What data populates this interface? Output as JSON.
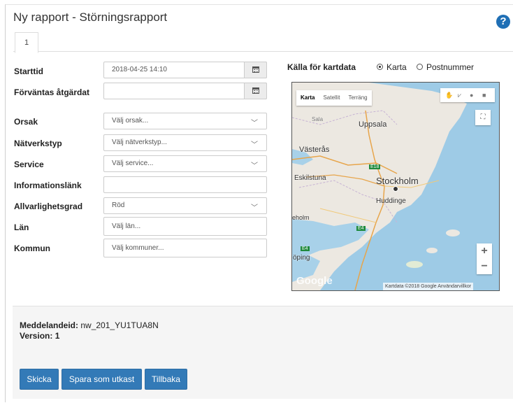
{
  "page": {
    "title": "Ny rapport - Störningsrapport",
    "help_icon": "question-circle-icon",
    "tabs": [
      {
        "label": "1"
      }
    ]
  },
  "form": {
    "starttid": {
      "label": "Starttid",
      "value": "2018-04-25 14:10"
    },
    "forvantas": {
      "label": "Förväntas åtgärdat",
      "value": ""
    },
    "orsak": {
      "label": "Orsak",
      "value": "Välj orsak..."
    },
    "natverkstyp": {
      "label": "Nätverkstyp",
      "value": "Välj nätverkstyp..."
    },
    "service": {
      "label": "Service",
      "value": "Välj service..."
    },
    "informationslank": {
      "label": "Informationslänk",
      "value": ""
    },
    "allvarlighetsgrad": {
      "label": "Allvarlighetsgrad",
      "value": "Röd"
    },
    "lan": {
      "label": "Län",
      "placeholder": "Välj län..."
    },
    "kommun": {
      "label": "Kommun",
      "placeholder": "Välj kommuner..."
    }
  },
  "map": {
    "source_label": "Källa för kartdata",
    "options": [
      {
        "label": "Karta",
        "selected": true
      },
      {
        "label": "Postnummer",
        "selected": false
      }
    ],
    "map_types": [
      "Karta",
      "Satellit",
      "Terräng"
    ],
    "places": {
      "uppsala": "Uppsala",
      "vasteras": "Västerås",
      "eskilstuna": "Eskilstuna",
      "stockholm": "Stockholm",
      "huddinge": "Huddinge",
      "e18": "E18",
      "e4": "E4",
      "e4b": "E4",
      "sala": "Sala",
      "koping": "öping",
      "holm": "eholm"
    },
    "zoom_in": "+",
    "zoom_out": "−",
    "logo": "Google",
    "credit": "Kartdata ©2018 Google   Användarvillkor"
  },
  "footer": {
    "meddelandeid_label": "Meddelandeid:",
    "meddelandeid_value": "nw_201_YU1TUA8N",
    "version_label": "Version:",
    "version_value": "1"
  },
  "buttons": {
    "skicka": "Skicka",
    "spara": "Spara som utkast",
    "tillbaka": "Tillbaka"
  },
  "colors": {
    "primary": "#337ab7",
    "water": "#9ecbe6",
    "land": "#ece8e1"
  }
}
